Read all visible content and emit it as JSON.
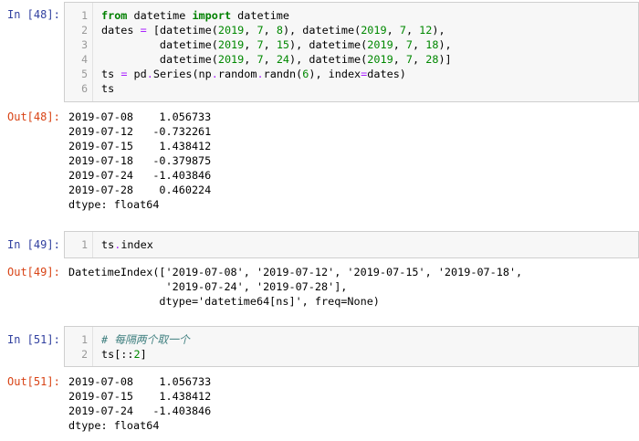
{
  "cells": [
    {
      "in_prompt": "In [48]:",
      "line_numbers": [
        "1",
        "2",
        "3",
        "4",
        "5",
        "6"
      ],
      "code_lines": [
        [
          {
            "t": "kw",
            "v": "from"
          },
          {
            "t": "",
            "v": " datetime "
          },
          {
            "t": "kw",
            "v": "import"
          },
          {
            "t": "",
            "v": " datetime"
          }
        ],
        [
          {
            "t": "",
            "v": "dates "
          },
          {
            "t": "op",
            "v": "="
          },
          {
            "t": "",
            "v": " [datetime("
          },
          {
            "t": "num",
            "v": "2019"
          },
          {
            "t": "",
            "v": ", "
          },
          {
            "t": "num",
            "v": "7"
          },
          {
            "t": "",
            "v": ", "
          },
          {
            "t": "num",
            "v": "8"
          },
          {
            "t": "",
            "v": "), datetime("
          },
          {
            "t": "num",
            "v": "2019"
          },
          {
            "t": "",
            "v": ", "
          },
          {
            "t": "num",
            "v": "7"
          },
          {
            "t": "",
            "v": ", "
          },
          {
            "t": "num",
            "v": "12"
          },
          {
            "t": "",
            "v": "),"
          }
        ],
        [
          {
            "t": "",
            "v": "         datetime("
          },
          {
            "t": "num",
            "v": "2019"
          },
          {
            "t": "",
            "v": ", "
          },
          {
            "t": "num",
            "v": "7"
          },
          {
            "t": "",
            "v": ", "
          },
          {
            "t": "num",
            "v": "15"
          },
          {
            "t": "",
            "v": "), datetime("
          },
          {
            "t": "num",
            "v": "2019"
          },
          {
            "t": "",
            "v": ", "
          },
          {
            "t": "num",
            "v": "7"
          },
          {
            "t": "",
            "v": ", "
          },
          {
            "t": "num",
            "v": "18"
          },
          {
            "t": "",
            "v": "),"
          }
        ],
        [
          {
            "t": "",
            "v": "         datetime("
          },
          {
            "t": "num",
            "v": "2019"
          },
          {
            "t": "",
            "v": ", "
          },
          {
            "t": "num",
            "v": "7"
          },
          {
            "t": "",
            "v": ", "
          },
          {
            "t": "num",
            "v": "24"
          },
          {
            "t": "",
            "v": "), datetime("
          },
          {
            "t": "num",
            "v": "2019"
          },
          {
            "t": "",
            "v": ", "
          },
          {
            "t": "num",
            "v": "7"
          },
          {
            "t": "",
            "v": ", "
          },
          {
            "t": "num",
            "v": "28"
          },
          {
            "t": "",
            "v": ")]"
          }
        ],
        [
          {
            "t": "",
            "v": "ts "
          },
          {
            "t": "op",
            "v": "="
          },
          {
            "t": "",
            "v": " pd"
          },
          {
            "t": "op",
            "v": "."
          },
          {
            "t": "",
            "v": "Series(np"
          },
          {
            "t": "op",
            "v": "."
          },
          {
            "t": "",
            "v": "random"
          },
          {
            "t": "op",
            "v": "."
          },
          {
            "t": "",
            "v": "randn("
          },
          {
            "t": "num",
            "v": "6"
          },
          {
            "t": "",
            "v": "), index"
          },
          {
            "t": "op",
            "v": "="
          },
          {
            "t": "",
            "v": "dates)"
          }
        ],
        [
          {
            "t": "",
            "v": "ts"
          }
        ]
      ],
      "out_prompt": "Out[48]:",
      "output_lines": [
        "2019-07-08    1.056733",
        "2019-07-12   -0.732261",
        "2019-07-15    1.438412",
        "2019-07-18   -0.379875",
        "2019-07-24   -1.403846",
        "2019-07-28    0.460224",
        "dtype: float64"
      ]
    },
    {
      "in_prompt": "In [49]:",
      "line_numbers": [
        "1"
      ],
      "code_lines": [
        [
          {
            "t": "",
            "v": "ts"
          },
          {
            "t": "op",
            "v": "."
          },
          {
            "t": "",
            "v": "index"
          }
        ]
      ],
      "out_prompt": "Out[49]:",
      "output_lines": [
        "DatetimeIndex(['2019-07-08', '2019-07-12', '2019-07-15', '2019-07-18',",
        "               '2019-07-24', '2019-07-28'],",
        "              dtype='datetime64[ns]', freq=None)"
      ]
    },
    {
      "in_prompt": "In [51]:",
      "line_numbers": [
        "1",
        "2"
      ],
      "code_lines": [
        [
          {
            "t": "cm",
            "v": "# 每隔两个取一个"
          }
        ],
        [
          {
            "t": "",
            "v": "ts[::"
          },
          {
            "t": "num",
            "v": "2"
          },
          {
            "t": "",
            "v": "]"
          }
        ]
      ],
      "out_prompt": "Out[51]:",
      "output_lines": [
        "2019-07-08    1.056733",
        "2019-07-15    1.438412",
        "2019-07-24   -1.403846",
        "dtype: float64"
      ]
    }
  ]
}
